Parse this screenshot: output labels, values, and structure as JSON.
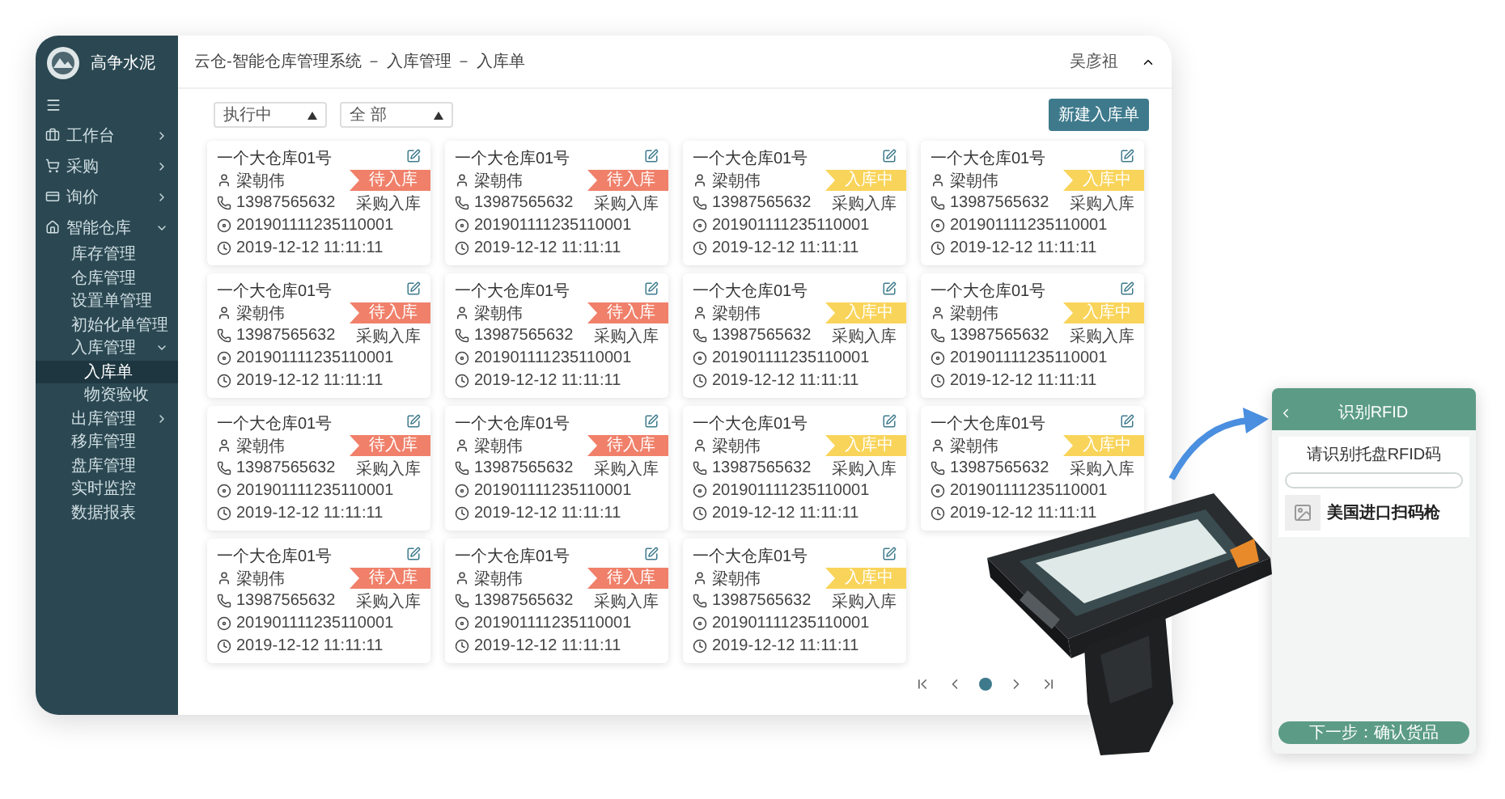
{
  "sidebar": {
    "brand": "高争水泥",
    "items": [
      {
        "label": "工作台",
        "expanded": false,
        "selected": false
      },
      {
        "label": "采购",
        "expanded": false,
        "selected": false
      },
      {
        "label": "询价",
        "expanded": false,
        "selected": false
      },
      {
        "label": "智能仓库",
        "expanded": true,
        "selected": false,
        "children": [
          {
            "label": "库存管理",
            "selected": false
          },
          {
            "label": "仓库管理",
            "selected": false
          },
          {
            "label": "设置单管理",
            "selected": false
          },
          {
            "label": "初始化单管理",
            "selected": false
          },
          {
            "label": "入库管理",
            "expanded": true,
            "selected": false,
            "children": [
              {
                "label": "入库单",
                "selected": true
              },
              {
                "label": "物资验收",
                "selected": false
              }
            ]
          },
          {
            "label": "出库管理",
            "expanded": false,
            "selected": false
          },
          {
            "label": "移库管理",
            "selected": false
          },
          {
            "label": "盘库管理",
            "selected": false
          },
          {
            "label": "实时监控",
            "selected": false
          },
          {
            "label": "数据报表",
            "selected": false
          }
        ]
      }
    ]
  },
  "header": {
    "breadcrumb": "云仓-智能仓库管理系统 － 入库管理 － 入库单",
    "user": "吴彦祖"
  },
  "filters": [
    {
      "value": "执行中"
    },
    {
      "value": "全 部"
    }
  ],
  "new_button": "新建入库单",
  "cards": [
    {
      "title": "一个大仓库01号",
      "person": "梁朝伟",
      "phone": "13987565632",
      "type": "采购入库",
      "code": "201901111235110001",
      "time": "2019-12-12  11:11:11",
      "status": {
        "label": "待入库",
        "color": "#f0806a"
      }
    },
    {
      "title": "一个大仓库01号",
      "person": "梁朝伟",
      "phone": "13987565632",
      "type": "采购入库",
      "code": "201901111235110001",
      "time": "2019-12-12  11:11:11",
      "status": {
        "label": "待入库",
        "color": "#f0806a"
      }
    },
    {
      "title": "一个大仓库01号",
      "person": "梁朝伟",
      "phone": "13987565632",
      "type": "采购入库",
      "code": "201901111235110001",
      "time": "2019-12-12  11:11:11",
      "status": {
        "label": "入库中",
        "color": "#f9d45a"
      }
    },
    {
      "title": "一个大仓库01号",
      "person": "梁朝伟",
      "phone": "13987565632",
      "type": "采购入库",
      "code": "201901111235110001",
      "time": "2019-12-12  11:11:11",
      "status": {
        "label": "入库中",
        "color": "#f9d45a"
      }
    },
    {
      "title": "一个大仓库01号",
      "person": "梁朝伟",
      "phone": "13987565632",
      "type": "采购入库",
      "code": "201901111235110001",
      "time": "2019-12-12  11:11:11",
      "status": {
        "label": "待入库",
        "color": "#f0806a"
      }
    },
    {
      "title": "一个大仓库01号",
      "person": "梁朝伟",
      "phone": "13987565632",
      "type": "采购入库",
      "code": "201901111235110001",
      "time": "2019-12-12  11:11:11",
      "status": {
        "label": "待入库",
        "color": "#f0806a"
      }
    },
    {
      "title": "一个大仓库01号",
      "person": "梁朝伟",
      "phone": "13987565632",
      "type": "采购入库",
      "code": "201901111235110001",
      "time": "2019-12-12  11:11:11",
      "status": {
        "label": "入库中",
        "color": "#f9d45a"
      }
    },
    {
      "title": "一个大仓库01号",
      "person": "梁朝伟",
      "phone": "13987565632",
      "type": "采购入库",
      "code": "201901111235110001",
      "time": "2019-12-12  11:11:11",
      "status": {
        "label": "入库中",
        "color": "#f9d45a"
      }
    },
    {
      "title": "一个大仓库01号",
      "person": "梁朝伟",
      "phone": "13987565632",
      "type": "采购入库",
      "code": "201901111235110001",
      "time": "2019-12-12  11:11:11",
      "status": {
        "label": "待入库",
        "color": "#f0806a"
      }
    },
    {
      "title": "一个大仓库01号",
      "person": "梁朝伟",
      "phone": "13987565632",
      "type": "采购入库",
      "code": "201901111235110001",
      "time": "2019-12-12  11:11:11",
      "status": {
        "label": "待入库",
        "color": "#f0806a"
      }
    },
    {
      "title": "一个大仓库01号",
      "person": "梁朝伟",
      "phone": "13987565632",
      "type": "采购入库",
      "code": "201901111235110001",
      "time": "2019-12-12  11:11:11",
      "status": {
        "label": "入库中",
        "color": "#f9d45a"
      }
    },
    {
      "title": "一个大仓库01号",
      "person": "梁朝伟",
      "phone": "13987565632",
      "type": "采购入库",
      "code": "201901111235110001",
      "time": "2019-12-12  11:11:11",
      "status": {
        "label": "入库中",
        "color": "#f9d45a"
      }
    },
    {
      "title": "一个大仓库01号",
      "person": "梁朝伟",
      "phone": "13987565632",
      "type": "采购入库",
      "code": "201901111235110001",
      "time": "2019-12-12  11:11:11",
      "status": {
        "label": "待入库",
        "color": "#f0806a"
      }
    },
    {
      "title": "一个大仓库01号",
      "person": "梁朝伟",
      "phone": "13987565632",
      "type": "采购入库",
      "code": "201901111235110001",
      "time": "2019-12-12  11:11:11",
      "status": {
        "label": "待入库",
        "color": "#f0806a"
      }
    },
    {
      "title": "一个大仓库01号",
      "person": "梁朝伟",
      "phone": "13987565632",
      "type": "采购入库",
      "code": "201901111235110001",
      "time": "2019-12-12  11:11:11",
      "status": {
        "label": "入库中",
        "color": "#f9d45a"
      }
    }
  ],
  "phone_screen": {
    "title": "识别RFID",
    "prompt": "请识别托盘RFID码",
    "item_name": "美国进口扫码枪",
    "next_button": "下一步：确认货品"
  }
}
